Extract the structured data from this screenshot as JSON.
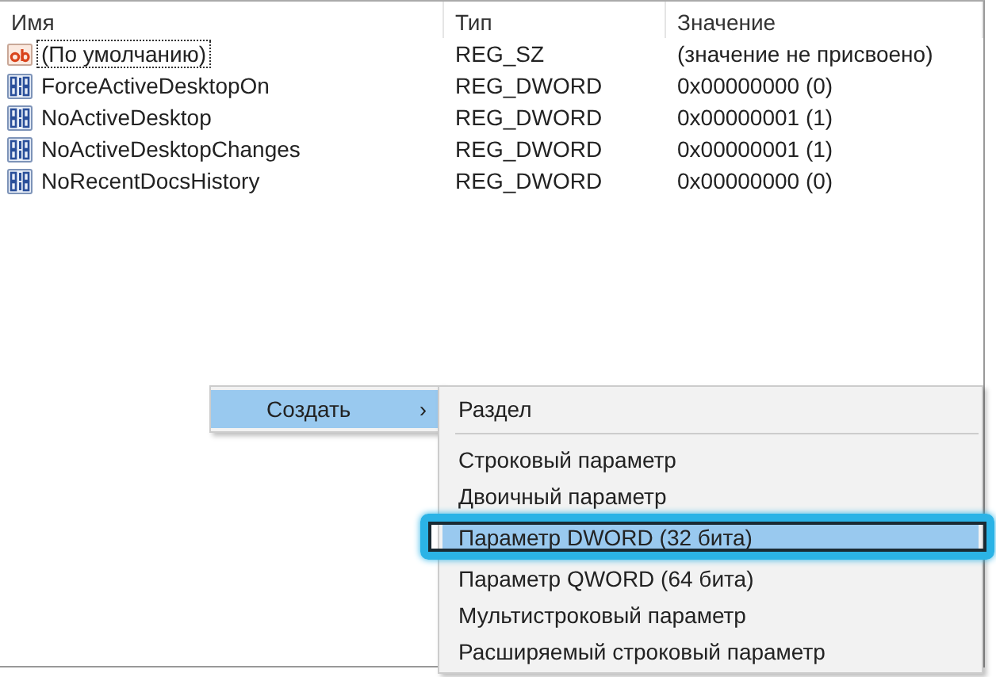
{
  "table": {
    "columns": [
      "Имя",
      "Тип",
      "Значение"
    ],
    "rows": [
      {
        "kind": "string",
        "name": "(По умолчанию)",
        "type": "REG_SZ",
        "value": "(значение не присвоено)",
        "focused": true
      },
      {
        "kind": "binary",
        "name": "ForceActiveDesktopOn",
        "type": "REG_DWORD",
        "value": "0x00000000 (0)",
        "focused": false
      },
      {
        "kind": "binary",
        "name": "NoActiveDesktop",
        "type": "REG_DWORD",
        "value": "0x00000001 (1)",
        "focused": false
      },
      {
        "kind": "binary",
        "name": "NoActiveDesktopChanges",
        "type": "REG_DWORD",
        "value": "0x00000001 (1)",
        "focused": false
      },
      {
        "kind": "binary",
        "name": "NoRecentDocsHistory",
        "type": "REG_DWORD",
        "value": "0x00000000 (0)",
        "focused": false
      }
    ]
  },
  "context_menu": {
    "items": [
      {
        "label": "Создать",
        "caret": "›",
        "selected": true
      }
    ]
  },
  "submenu": {
    "items": [
      {
        "kind": "item",
        "label": "Раздел",
        "selected": false
      },
      {
        "kind": "separator"
      },
      {
        "kind": "item",
        "label": "Строковый параметр",
        "selected": false
      },
      {
        "kind": "item",
        "label": "Двоичный параметр",
        "selected": false
      },
      {
        "kind": "item",
        "label": "Параметр DWORD (32 бита)",
        "selected": true
      },
      {
        "kind": "item",
        "label": "Параметр QWORD (64 бита)",
        "selected": false
      },
      {
        "kind": "item",
        "label": "Мультистроковый параметр",
        "selected": false
      },
      {
        "kind": "item",
        "label": "Расширяемый строковый параметр",
        "selected": false
      }
    ]
  }
}
